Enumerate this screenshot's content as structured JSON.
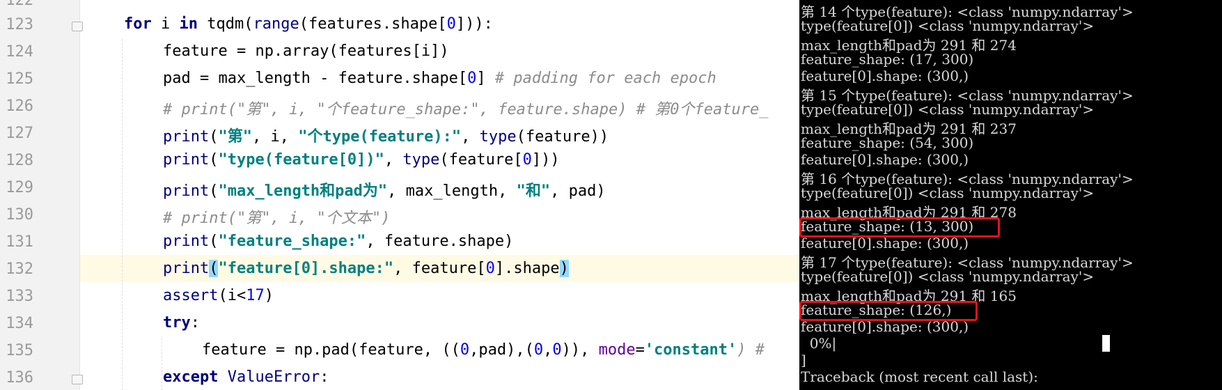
{
  "editor": {
    "lines": [
      {
        "n": "122"
      },
      {
        "n": "123"
      },
      {
        "n": "124"
      },
      {
        "n": "125"
      },
      {
        "n": "126"
      },
      {
        "n": "127"
      },
      {
        "n": "128"
      },
      {
        "n": "129"
      },
      {
        "n": "130"
      },
      {
        "n": "131"
      },
      {
        "n": "132"
      },
      {
        "n": "133"
      },
      {
        "n": "134"
      },
      {
        "n": "135"
      },
      {
        "n": "136"
      }
    ],
    "code": {
      "l123": {
        "k": "for",
        "a": " i ",
        "k2": "in",
        "b": " tqdm(",
        "bi": "range",
        "c": "(features.shape[",
        "n": "0",
        "d": "])):"
      },
      "l124": {
        "a": "feature = np.array(features[i])"
      },
      "l125": {
        "a": "pad = max_length - feature.shape[",
        "n": "0",
        "b": "]",
        "cm": " # padding for each epoch"
      },
      "l126": {
        "cm": "# print(\"第\", i, \"个feature_shape:\", feature.shape) # 第0个feature_"
      },
      "l127": {
        "p": "print",
        "a": "(",
        "s": "\"第\"",
        "b": ", i, ",
        "s2": "\"个type(feature):\"",
        "c": ", ",
        "t": "type",
        "d": "(feature))"
      },
      "l128": {
        "p": "print",
        "a": "(",
        "s": "\"type(feature[0])\"",
        "b": ", ",
        "t": "type",
        "c": "(feature[",
        "n": "0",
        "d": "]))"
      },
      "l129": {
        "p": "print",
        "a": "(",
        "s": "\"max_length和pad为\"",
        "b": ", max_length, ",
        "s2": "\"和\"",
        "c": ", pad)"
      },
      "l130": {
        "cm": "# print(\"第\", i, \"个文本\")"
      },
      "l131": {
        "p": "print",
        "a": "(",
        "s": "\"feature_shape:\"",
        "b": ", feature.shape)"
      },
      "l132": {
        "p": "print",
        "a": "(",
        "s": "\"feature[0].shape:\"",
        "b": ", feature[",
        "n": "0",
        "c": "].shape",
        "d": ")"
      },
      "l133": {
        "p": "assert",
        "a": "(i<",
        "n": "17",
        "b": ")"
      },
      "l134": {
        "k": "try",
        "a": ":"
      },
      "l135": {
        "a": "feature = np.pad(feature, ((",
        "n1": "0",
        "b": ",pad),(",
        "n2": "0",
        "c": ",",
        "n3": "0",
        "d": ")), ",
        "kw": "mode",
        "e": "=",
        "s": "'constant'",
        "f": ") #"
      },
      "l136": {
        "k": "except",
        "a": " ",
        "bi": "ValueError",
        "b": ":"
      }
    }
  },
  "terminal": {
    "lines": [
      "第 14 个type(feature): <class 'numpy.ndarray'>",
      "type(feature[0]) <class 'numpy.ndarray'>",
      "max_length和pad为 291 和 274",
      "feature_shape: (17, 300)",
      "feature[0].shape: (300,)",
      "第 15 个type(feature): <class 'numpy.ndarray'>",
      "type(feature[0]) <class 'numpy.ndarray'>",
      "max_length和pad为 291 和 237",
      "feature_shape: (54, 300)",
      "feature[0].shape: (300,)",
      "第 16 个type(feature): <class 'numpy.ndarray'>",
      "type(feature[0]) <class 'numpy.ndarray'>",
      "max_length和pad为 291 和 278",
      "feature_shape: (13, 300)",
      "feature[0].shape: (300,)",
      "第 17 个type(feature): <class 'numpy.ndarray'>",
      "type(feature[0]) <class 'numpy.ndarray'>",
      "max_length和pad为 291 和 165",
      "feature_shape: (126,)",
      "feature[0].shape: (300,)",
      "  0%|",
      "]",
      "Traceback (most recent call last):"
    ]
  }
}
